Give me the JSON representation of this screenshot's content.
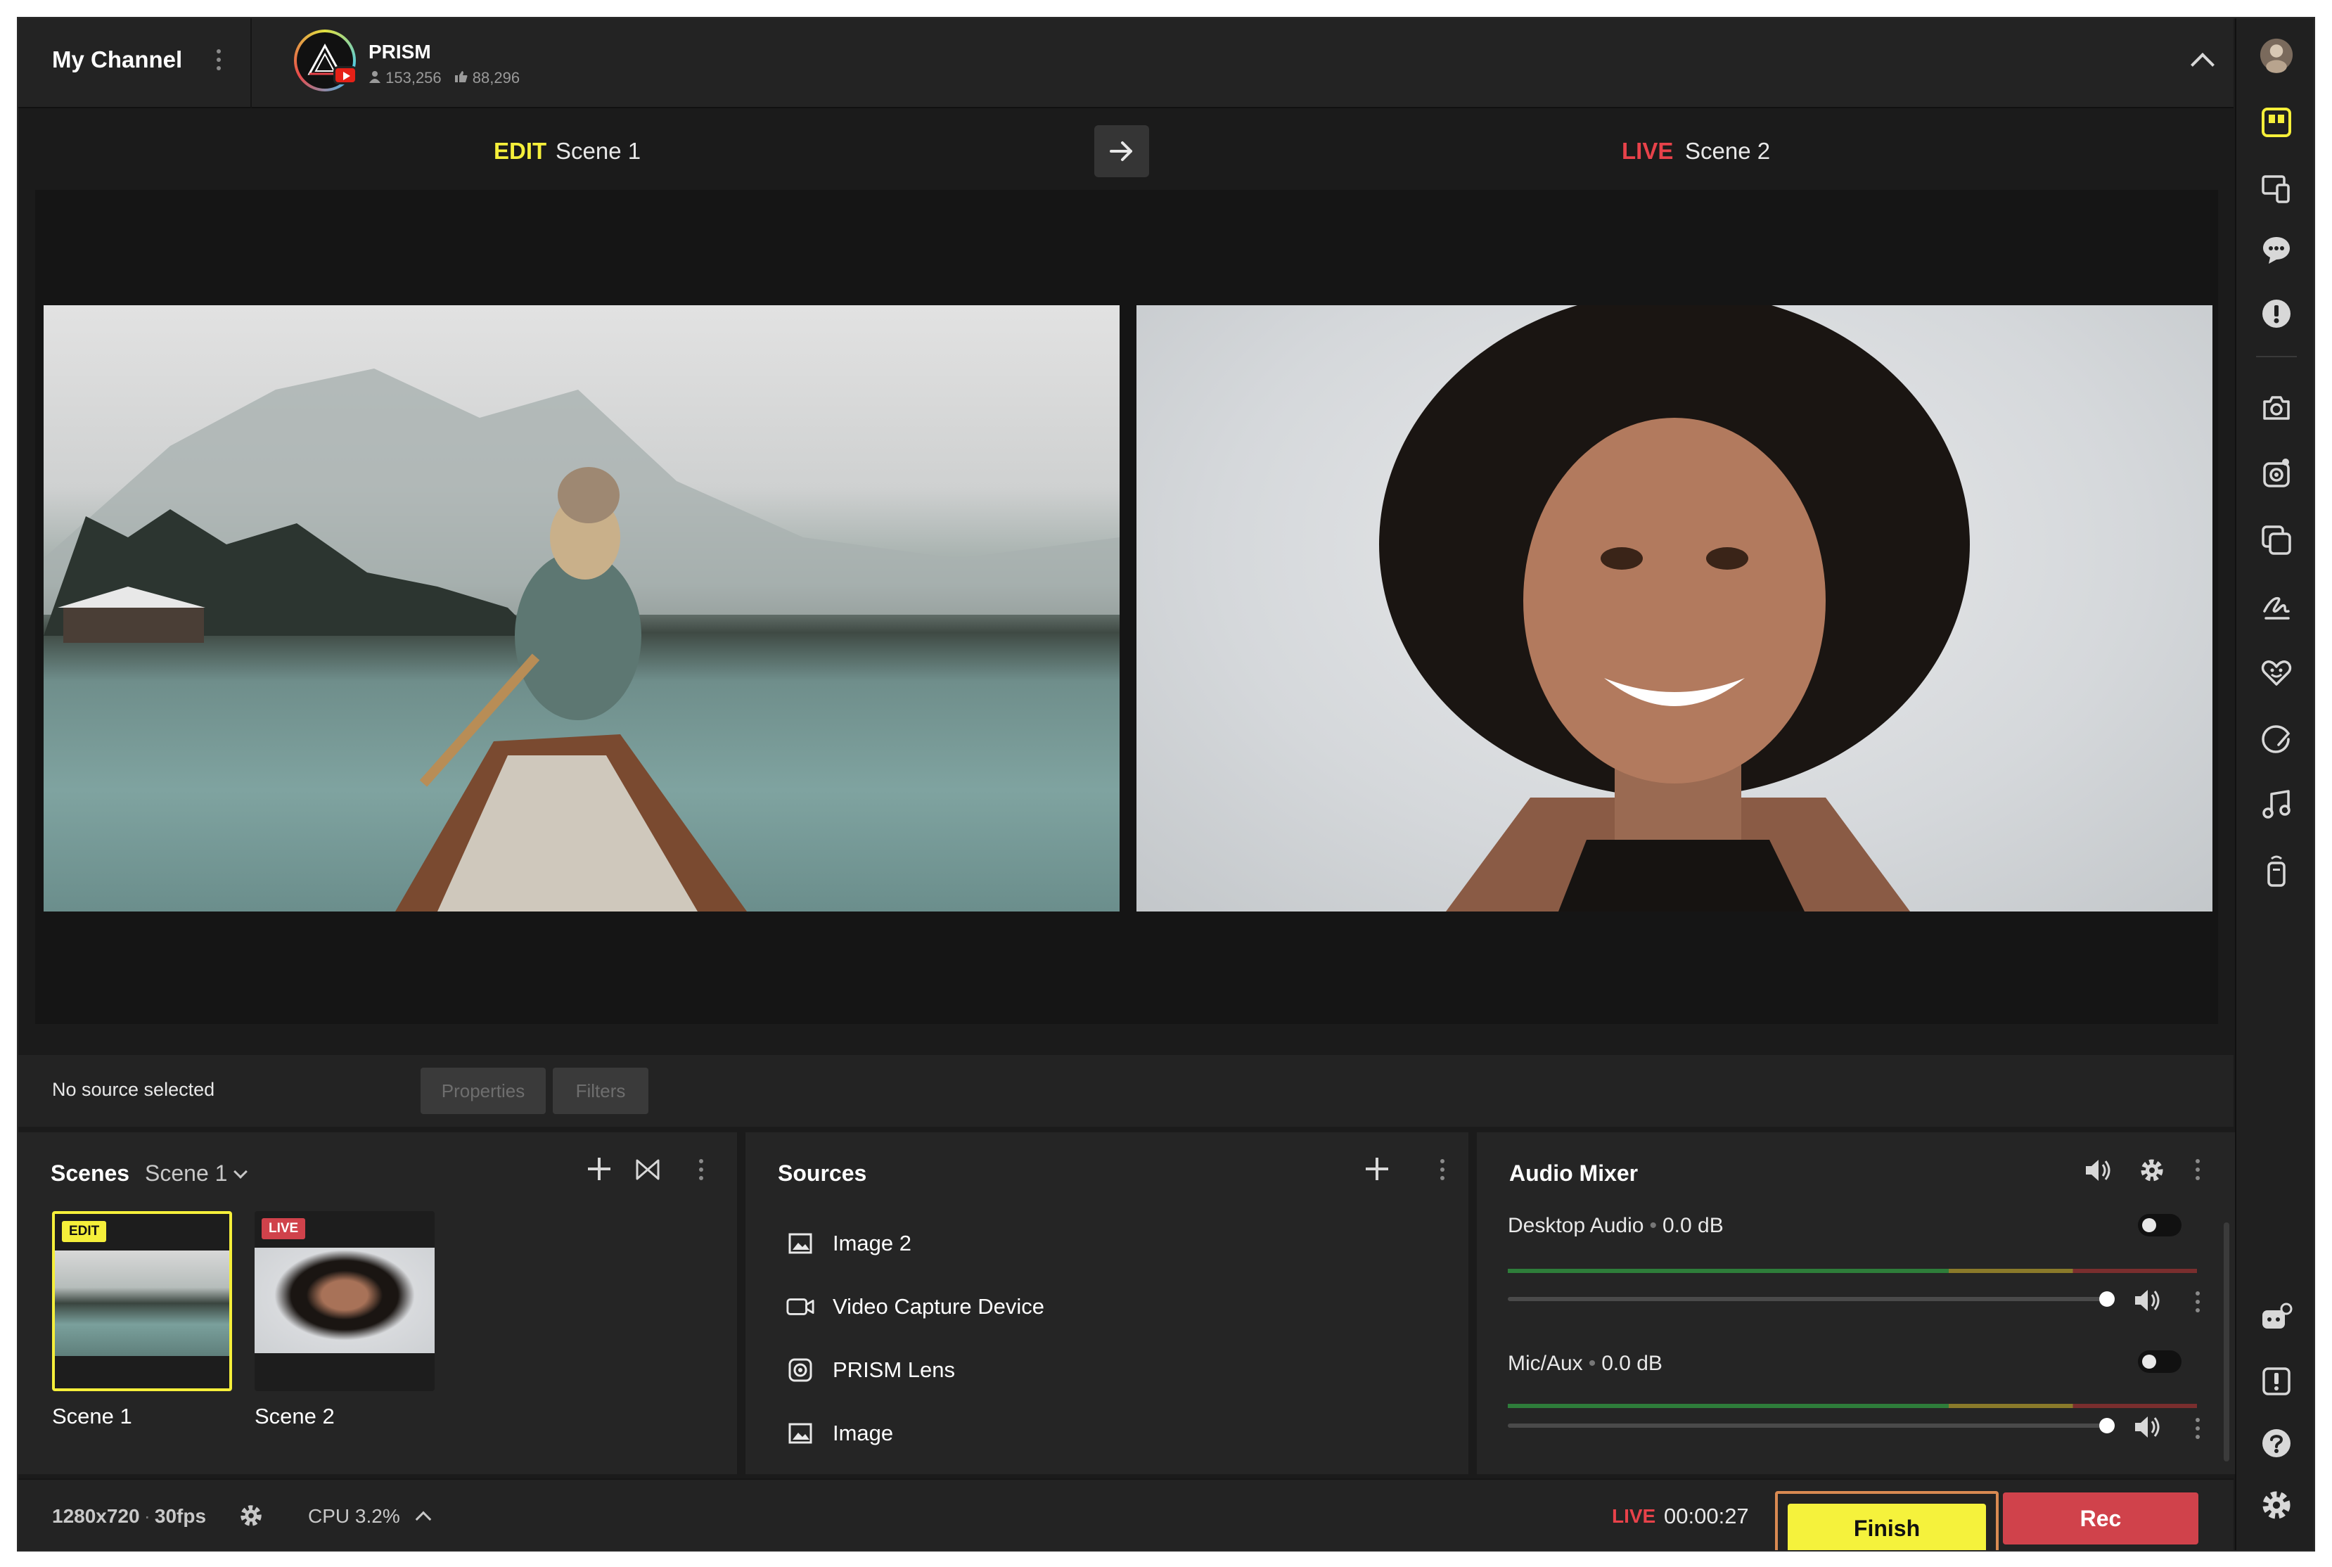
{
  "header": {
    "channel_title": "My Channel",
    "platform_name": "PRISM",
    "followers": "153,256",
    "likes": "88,296"
  },
  "preview": {
    "edit_label": "EDIT",
    "edit_scene": "Scene 1",
    "live_label": "LIVE",
    "live_scene": "Scene 2"
  },
  "source_bar": {
    "status": "No source selected",
    "properties_label": "Properties",
    "filters_label": "Filters"
  },
  "scenes": {
    "title": "Scenes",
    "current": "Scene 1",
    "items": [
      {
        "name": "Scene 1",
        "badge": "EDIT"
      },
      {
        "name": "Scene 2",
        "badge": "LIVE"
      }
    ]
  },
  "sources": {
    "title": "Sources",
    "items": [
      {
        "label": "Image 2",
        "icon": "image-icon"
      },
      {
        "label": "Video Capture Device",
        "icon": "video-capture-icon"
      },
      {
        "label": "PRISM Lens",
        "icon": "prism-lens-icon"
      },
      {
        "label": "Image",
        "icon": "image-icon"
      }
    ]
  },
  "audio_mixer": {
    "title": "Audio Mixer",
    "channels": [
      {
        "name": "Desktop Audio",
        "level": "0.0 dB",
        "volume": 1.0
      },
      {
        "name": "Mic/Aux",
        "level": "0.0 dB",
        "volume": 1.0
      }
    ]
  },
  "status": {
    "resolution": "1280x720",
    "fps": "30fps",
    "cpu": "CPU 3.2%",
    "live_label": "LIVE",
    "elapsed": "00:00:27",
    "finish_label": "Finish",
    "rec_label": "Rec"
  },
  "colors": {
    "edit_accent": "#f5ef3a",
    "live_accent": "#e8424a",
    "rec_button": "#d0424b",
    "finish_button": "#f5f23c"
  }
}
